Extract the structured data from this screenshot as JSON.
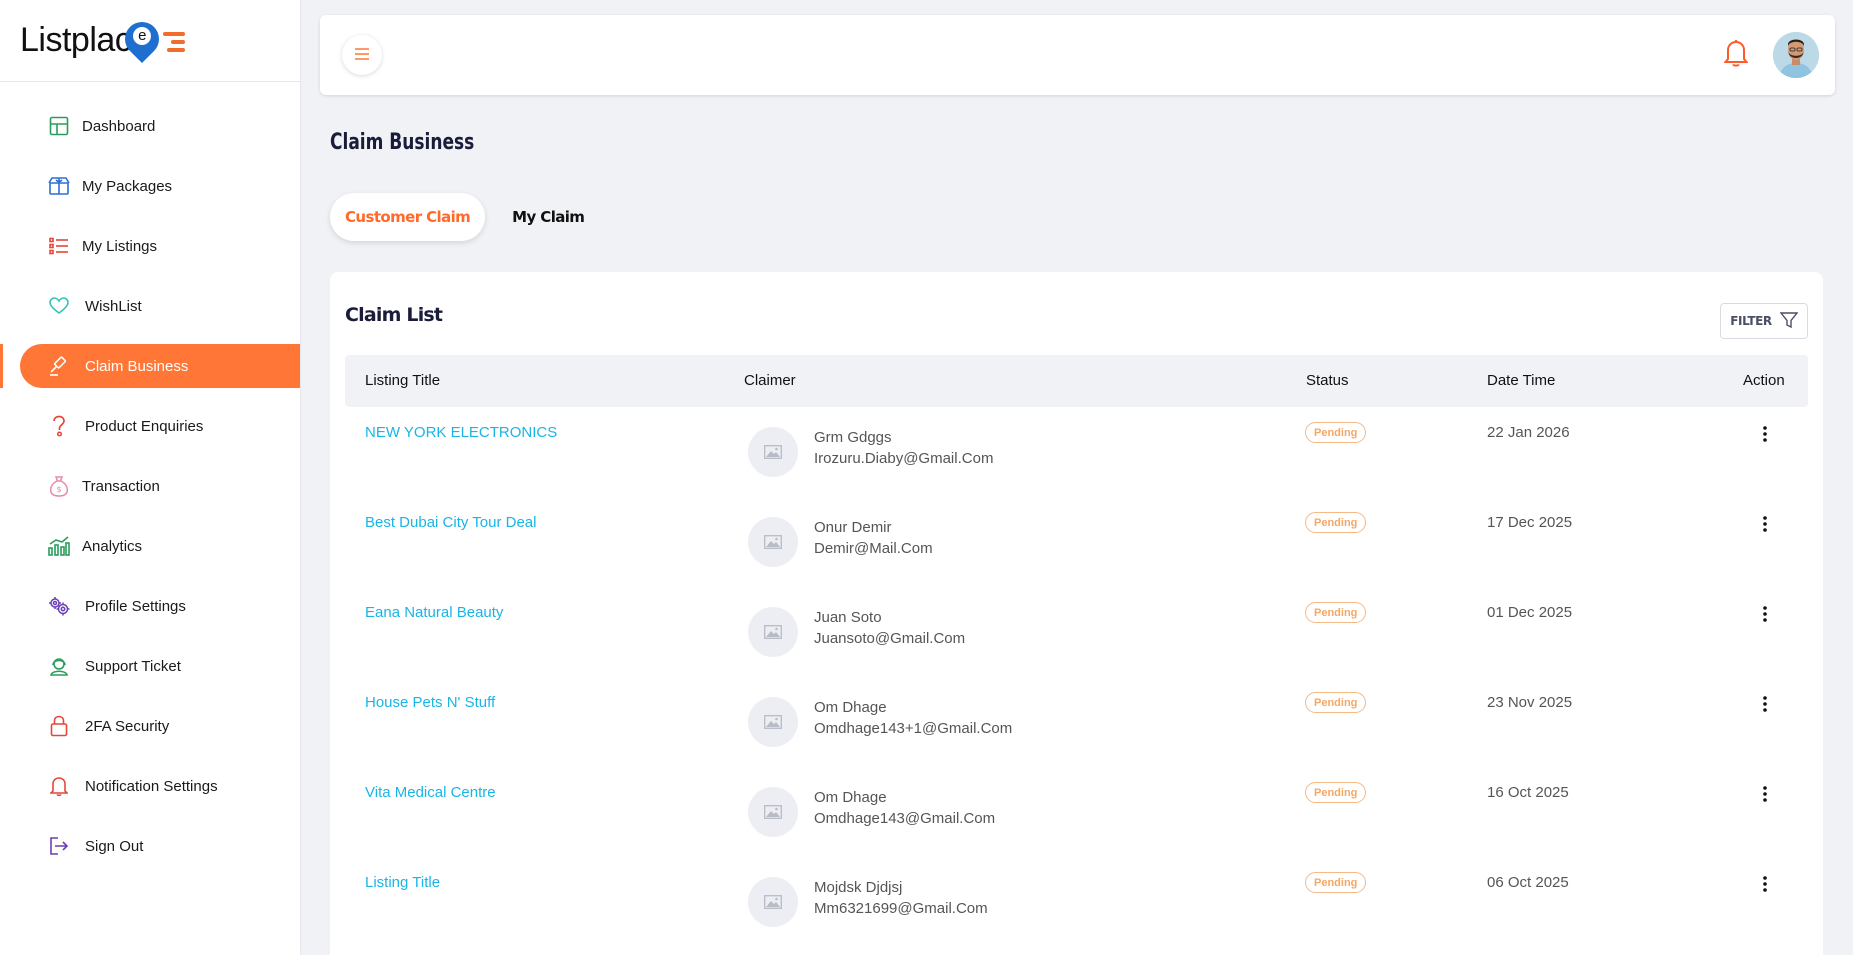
{
  "brand": {
    "logo_text": "Listplac",
    "logo_pin_letter": "e"
  },
  "colors": {
    "accent": "#ff7636",
    "link": "#19b5e6",
    "pending": "#f5a764",
    "navy": "#1a1d3a"
  },
  "sidebar": {
    "items": [
      {
        "label": "Dashboard",
        "icon": "grid-icon"
      },
      {
        "label": "My Packages",
        "icon": "package-icon"
      },
      {
        "label": "My Listings",
        "icon": "list-icon"
      },
      {
        "label": "WishList",
        "icon": "heart-icon"
      },
      {
        "label": "Claim Business",
        "icon": "gavel-icon",
        "active": true
      },
      {
        "label": "Product Enquiries",
        "icon": "question-icon"
      },
      {
        "label": "Transaction",
        "icon": "money-bag-icon"
      },
      {
        "label": "Analytics",
        "icon": "chart-icon"
      },
      {
        "label": "Profile Settings",
        "icon": "gears-icon"
      },
      {
        "label": "Support Ticket",
        "icon": "support-icon"
      },
      {
        "label": "2FA Security",
        "icon": "lock-icon"
      },
      {
        "label": "Notification Settings",
        "icon": "bell-icon"
      },
      {
        "label": "Sign Out",
        "icon": "sign-out-icon"
      }
    ]
  },
  "page": {
    "title": "Claim Business"
  },
  "tabs": [
    {
      "label": "Customer Claim",
      "active": true
    },
    {
      "label": "My Claim",
      "active": false
    }
  ],
  "card": {
    "title": "Claim List",
    "filter_label": "FILTER"
  },
  "table": {
    "columns": [
      "Listing Title",
      "Claimer",
      "Status",
      "Date Time",
      "Action"
    ],
    "rows": [
      {
        "title": "NEW YORK ELECTRONICS",
        "name": "Grm Gdggs",
        "email": "Irozuru.Diaby@Gmail.Com",
        "status": "Pending",
        "date": "22 Jan 2026"
      },
      {
        "title": "Best Dubai City Tour Deal",
        "name": "Onur Demir",
        "email": "Demir@Mail.Com",
        "status": "Pending",
        "date": "17 Dec 2025"
      },
      {
        "title": "Eana Natural Beauty",
        "name": "Juan Soto",
        "email": "Juansoto@Gmail.Com",
        "status": "Pending",
        "date": "01 Dec 2025"
      },
      {
        "title": "House Pets N' Stuff",
        "name": "Om Dhage",
        "email": "Omdhage143+1@Gmail.Com",
        "status": "Pending",
        "date": "23 Nov 2025"
      },
      {
        "title": "Vita Medical Centre",
        "name": "Om Dhage",
        "email": "Omdhage143@Gmail.Com",
        "status": "Pending",
        "date": "16 Oct 2025"
      },
      {
        "title": "Listing Title",
        "name": "Mojdsk Djdjsj",
        "email": "Mm6321699@Gmail.Com",
        "status": "Pending",
        "date": "06 Oct 2025"
      }
    ]
  }
}
